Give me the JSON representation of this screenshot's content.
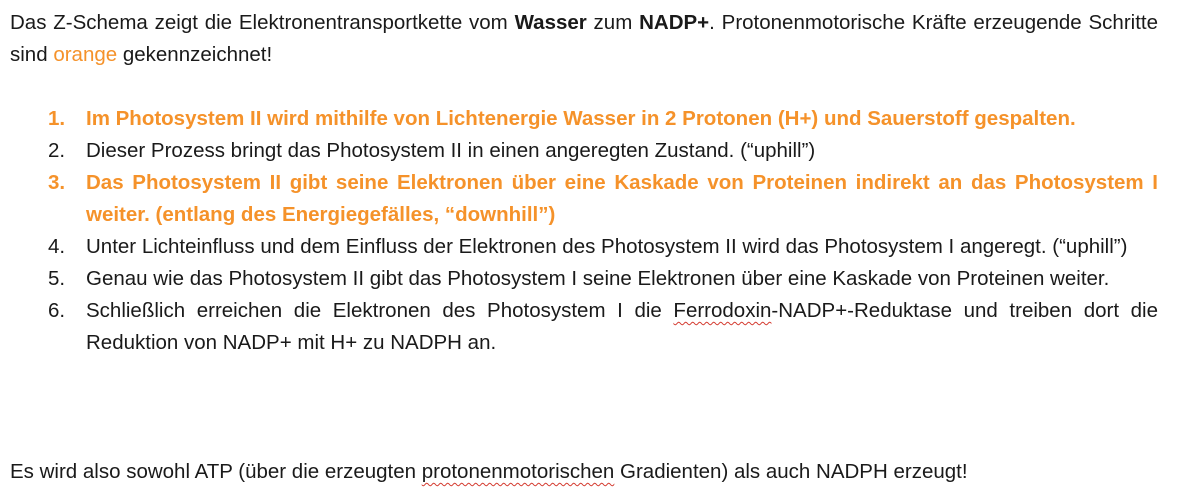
{
  "intro": {
    "p1": "Das Z-Schema zeigt die Elektronentransportkette vom ",
    "bold1": "Wasser",
    "p2": " zum ",
    "bold2": "NADP+",
    "p3": ". Protonenmotorische Kräfte erzeugende Schritte sind ",
    "orange_word": "orange",
    "p4": " gekennzeichnet!"
  },
  "steps": [
    {
      "number": "1.",
      "pre": "Im Photosystem II wird mithilfe von Lichtenergie ",
      "bold": "Wasser",
      "post": " in 2 Protonen (H+) und Sauerstoff gespalten.",
      "highlight": true
    },
    {
      "number": "2.",
      "text": "Dieser Prozess bringt das Photosystem II in einen angeregten Zustand. (“uphill”)",
      "highlight": false
    },
    {
      "number": "3.",
      "text": "Das Photosystem II gibt seine Elektronen über eine Kaskade von Proteinen indirekt an das Photosystem I weiter. (entlang des Energiegefälles, “downhill”)",
      "highlight": true
    },
    {
      "number": "4.",
      "text": "Unter Lichteinfluss und dem Einfluss der Elektronen des Photosystem II wird das Photosystem I angeregt. (“uphill”)",
      "highlight": false
    },
    {
      "number": "5.",
      "text": "Genau wie das Photosystem II gibt das Photosystem I seine Elektronen über eine Kaskade von Proteinen weiter.",
      "highlight": false
    },
    {
      "number": "6.",
      "pre": "Schließlich erreichen die Elektronen des Photosystem I die ",
      "flagged": "Ferrodoxin",
      "post": "-NADP+-Reduktase und treiben dort die Reduktion von NADP+ mit H+ zu NADPH an.",
      "highlight": false
    }
  ],
  "outro": {
    "pre": "Es wird also sowohl ATP (über die erzeugten ",
    "flagged": "protonenmotorischen",
    "post": " Gradienten) als auch NADPH erzeugt!"
  },
  "colors": {
    "accent_orange": "#f5922a",
    "text": "#1a1a1a",
    "spellcheck_underline": "#d43a2f"
  }
}
